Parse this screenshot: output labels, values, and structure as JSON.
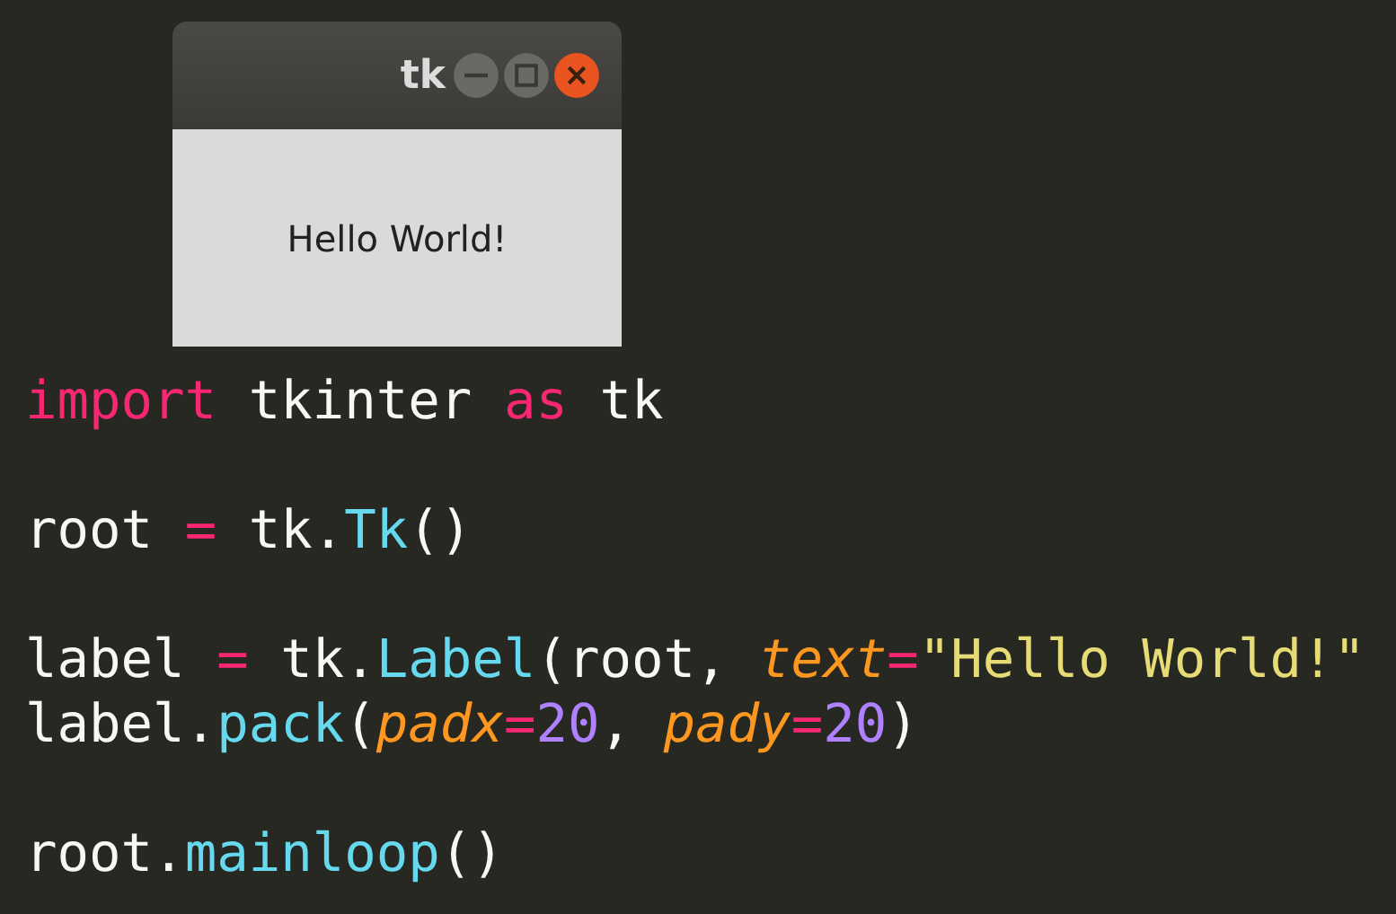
{
  "tk_window": {
    "title": "tk",
    "label": "Hello World!"
  },
  "code_blocks": [
    [
      [
        {
          "kind": "keyword",
          "text": "import"
        },
        {
          "kind": "plain",
          "text": " tkinter "
        },
        {
          "kind": "keyword",
          "text": "as"
        },
        {
          "kind": "plain",
          "text": " tk"
        }
      ]
    ],
    [
      [
        {
          "kind": "plain",
          "text": "root "
        },
        {
          "kind": "operator",
          "text": "="
        },
        {
          "kind": "plain",
          "text": " tk."
        },
        {
          "kind": "function",
          "text": "Tk"
        },
        {
          "kind": "plain",
          "text": "()"
        }
      ]
    ],
    [
      [
        {
          "kind": "plain",
          "text": "label "
        },
        {
          "kind": "operator",
          "text": "="
        },
        {
          "kind": "plain",
          "text": " tk."
        },
        {
          "kind": "function",
          "text": "Label"
        },
        {
          "kind": "plain",
          "text": "(root, "
        },
        {
          "kind": "param",
          "text": "text"
        },
        {
          "kind": "operator",
          "text": "="
        },
        {
          "kind": "string",
          "text": "\"Hello World!\""
        }
      ],
      [
        {
          "kind": "plain",
          "text": "label."
        },
        {
          "kind": "function",
          "text": "pack"
        },
        {
          "kind": "plain",
          "text": "("
        },
        {
          "kind": "param",
          "text": "padx"
        },
        {
          "kind": "operator",
          "text": "="
        },
        {
          "kind": "number",
          "text": "20"
        },
        {
          "kind": "plain",
          "text": ", "
        },
        {
          "kind": "param",
          "text": "pady"
        },
        {
          "kind": "operator",
          "text": "="
        },
        {
          "kind": "number",
          "text": "20"
        },
        {
          "kind": "plain",
          "text": ")"
        }
      ]
    ],
    [
      [
        {
          "kind": "plain",
          "text": "root."
        },
        {
          "kind": "function",
          "text": "mainloop"
        },
        {
          "kind": "plain",
          "text": "()"
        }
      ]
    ]
  ]
}
